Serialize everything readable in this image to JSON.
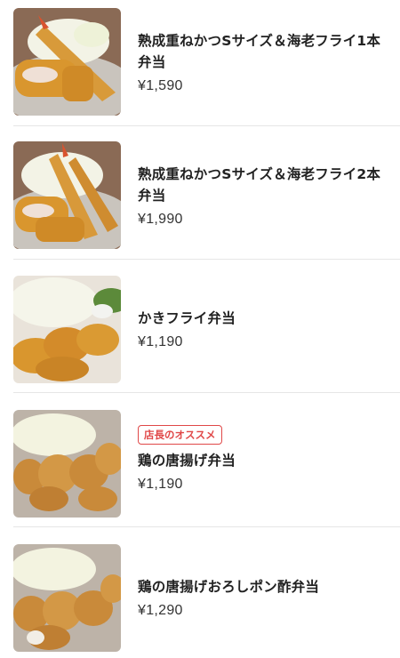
{
  "items": [
    {
      "name": "熟成重ねかつSサイズ＆海老フライ1本弁当",
      "price": "¥1,590",
      "badge": "",
      "image_icon": "katsu-ebi-1-bento-image"
    },
    {
      "name": "熟成重ねかつSサイズ＆海老フライ2本弁当",
      "price": "¥1,990",
      "badge": "",
      "image_icon": "katsu-ebi-2-bento-image"
    },
    {
      "name": "かきフライ弁当",
      "price": "¥1,190",
      "badge": "",
      "image_icon": "kaki-fry-bento-image"
    },
    {
      "name": "鶏の唐揚げ弁当",
      "price": "¥1,190",
      "badge": "店長のオススメ",
      "image_icon": "karaage-bento-image"
    },
    {
      "name": "鶏の唐揚げおろしポン酢弁当",
      "price": "¥1,290",
      "badge": "",
      "image_icon": "karaage-oroshi-ponzu-bento-image"
    }
  ],
  "colors": {
    "badge": "#e04848",
    "divider": "#e6e6e6",
    "text": "#222222"
  }
}
